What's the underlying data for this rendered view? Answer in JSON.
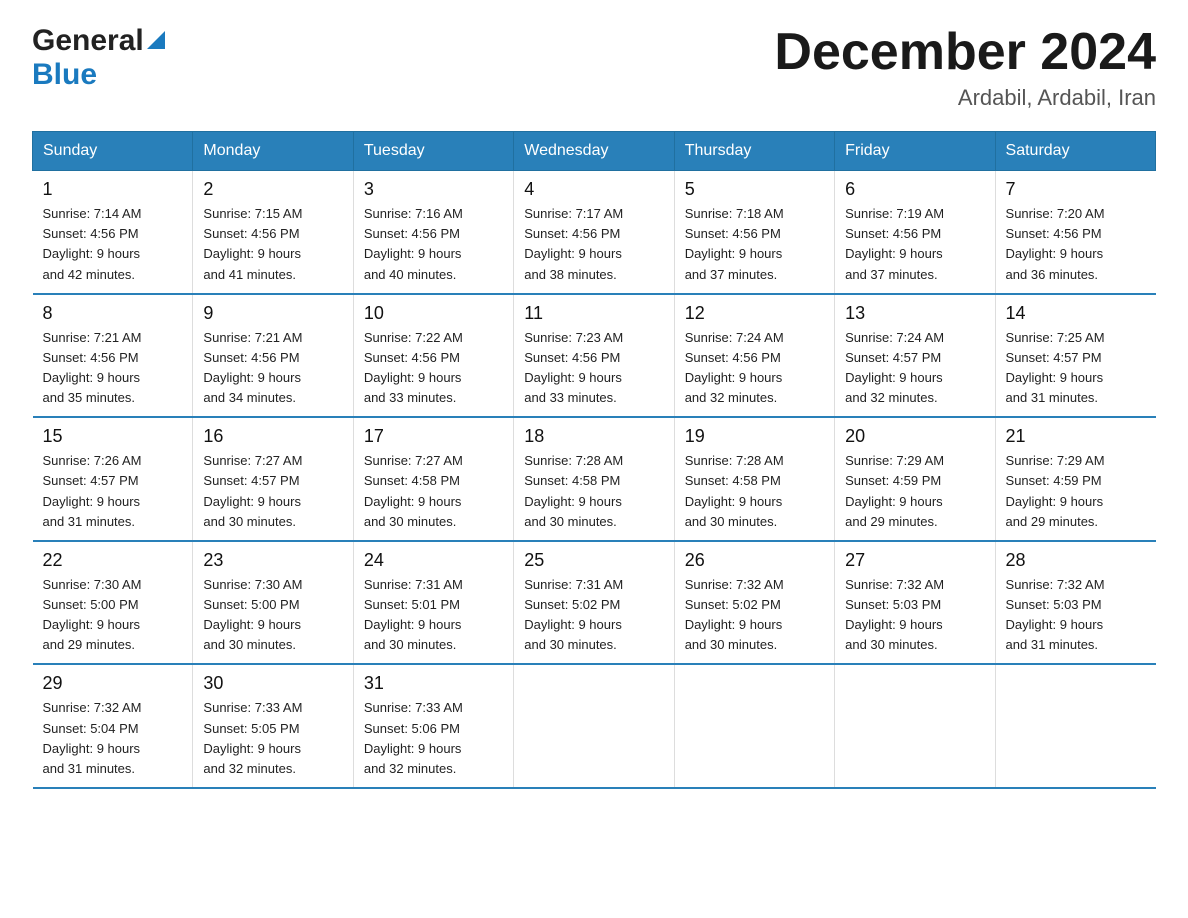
{
  "logo": {
    "general": "General",
    "blue": "Blue",
    "arrow": "▶"
  },
  "header": {
    "month_year": "December 2024",
    "location": "Ardabil, Ardabil, Iran"
  },
  "days_of_week": [
    "Sunday",
    "Monday",
    "Tuesday",
    "Wednesday",
    "Thursday",
    "Friday",
    "Saturday"
  ],
  "weeks": [
    [
      {
        "num": "1",
        "sunrise": "7:14 AM",
        "sunset": "4:56 PM",
        "daylight": "9 hours and 42 minutes."
      },
      {
        "num": "2",
        "sunrise": "7:15 AM",
        "sunset": "4:56 PM",
        "daylight": "9 hours and 41 minutes."
      },
      {
        "num": "3",
        "sunrise": "7:16 AM",
        "sunset": "4:56 PM",
        "daylight": "9 hours and 40 minutes."
      },
      {
        "num": "4",
        "sunrise": "7:17 AM",
        "sunset": "4:56 PM",
        "daylight": "9 hours and 38 minutes."
      },
      {
        "num": "5",
        "sunrise": "7:18 AM",
        "sunset": "4:56 PM",
        "daylight": "9 hours and 37 minutes."
      },
      {
        "num": "6",
        "sunrise": "7:19 AM",
        "sunset": "4:56 PM",
        "daylight": "9 hours and 37 minutes."
      },
      {
        "num": "7",
        "sunrise": "7:20 AM",
        "sunset": "4:56 PM",
        "daylight": "9 hours and 36 minutes."
      }
    ],
    [
      {
        "num": "8",
        "sunrise": "7:21 AM",
        "sunset": "4:56 PM",
        "daylight": "9 hours and 35 minutes."
      },
      {
        "num": "9",
        "sunrise": "7:21 AM",
        "sunset": "4:56 PM",
        "daylight": "9 hours and 34 minutes."
      },
      {
        "num": "10",
        "sunrise": "7:22 AM",
        "sunset": "4:56 PM",
        "daylight": "9 hours and 33 minutes."
      },
      {
        "num": "11",
        "sunrise": "7:23 AM",
        "sunset": "4:56 PM",
        "daylight": "9 hours and 33 minutes."
      },
      {
        "num": "12",
        "sunrise": "7:24 AM",
        "sunset": "4:56 PM",
        "daylight": "9 hours and 32 minutes."
      },
      {
        "num": "13",
        "sunrise": "7:24 AM",
        "sunset": "4:57 PM",
        "daylight": "9 hours and 32 minutes."
      },
      {
        "num": "14",
        "sunrise": "7:25 AM",
        "sunset": "4:57 PM",
        "daylight": "9 hours and 31 minutes."
      }
    ],
    [
      {
        "num": "15",
        "sunrise": "7:26 AM",
        "sunset": "4:57 PM",
        "daylight": "9 hours and 31 minutes."
      },
      {
        "num": "16",
        "sunrise": "7:27 AM",
        "sunset": "4:57 PM",
        "daylight": "9 hours and 30 minutes."
      },
      {
        "num": "17",
        "sunrise": "7:27 AM",
        "sunset": "4:58 PM",
        "daylight": "9 hours and 30 minutes."
      },
      {
        "num": "18",
        "sunrise": "7:28 AM",
        "sunset": "4:58 PM",
        "daylight": "9 hours and 30 minutes."
      },
      {
        "num": "19",
        "sunrise": "7:28 AM",
        "sunset": "4:58 PM",
        "daylight": "9 hours and 30 minutes."
      },
      {
        "num": "20",
        "sunrise": "7:29 AM",
        "sunset": "4:59 PM",
        "daylight": "9 hours and 29 minutes."
      },
      {
        "num": "21",
        "sunrise": "7:29 AM",
        "sunset": "4:59 PM",
        "daylight": "9 hours and 29 minutes."
      }
    ],
    [
      {
        "num": "22",
        "sunrise": "7:30 AM",
        "sunset": "5:00 PM",
        "daylight": "9 hours and 29 minutes."
      },
      {
        "num": "23",
        "sunrise": "7:30 AM",
        "sunset": "5:00 PM",
        "daylight": "9 hours and 30 minutes."
      },
      {
        "num": "24",
        "sunrise": "7:31 AM",
        "sunset": "5:01 PM",
        "daylight": "9 hours and 30 minutes."
      },
      {
        "num": "25",
        "sunrise": "7:31 AM",
        "sunset": "5:02 PM",
        "daylight": "9 hours and 30 minutes."
      },
      {
        "num": "26",
        "sunrise": "7:32 AM",
        "sunset": "5:02 PM",
        "daylight": "9 hours and 30 minutes."
      },
      {
        "num": "27",
        "sunrise": "7:32 AM",
        "sunset": "5:03 PM",
        "daylight": "9 hours and 30 minutes."
      },
      {
        "num": "28",
        "sunrise": "7:32 AM",
        "sunset": "5:03 PM",
        "daylight": "9 hours and 31 minutes."
      }
    ],
    [
      {
        "num": "29",
        "sunrise": "7:32 AM",
        "sunset": "5:04 PM",
        "daylight": "9 hours and 31 minutes."
      },
      {
        "num": "30",
        "sunrise": "7:33 AM",
        "sunset": "5:05 PM",
        "daylight": "9 hours and 32 minutes."
      },
      {
        "num": "31",
        "sunrise": "7:33 AM",
        "sunset": "5:06 PM",
        "daylight": "9 hours and 32 minutes."
      },
      null,
      null,
      null,
      null
    ]
  ],
  "labels": {
    "sunrise": "Sunrise:",
    "sunset": "Sunset:",
    "daylight": "Daylight:"
  }
}
